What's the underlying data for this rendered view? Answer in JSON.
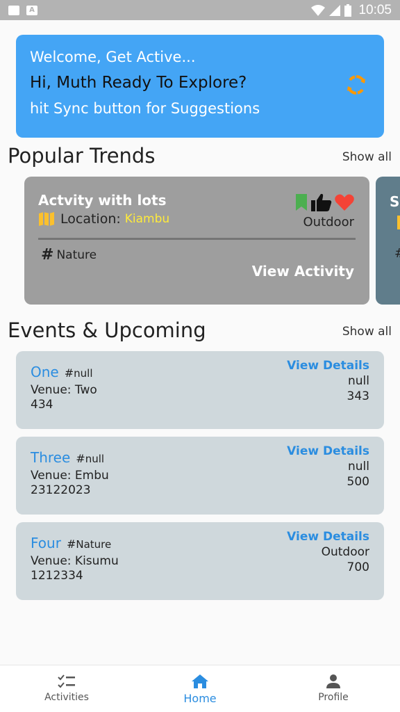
{
  "status_bar": {
    "time": "10:05"
  },
  "hero": {
    "greeting": "Welcome, Get Active...",
    "user_line": "Hi, Muth Ready To Explore?",
    "hint": "hit Sync button for Suggestions",
    "sync_icon": "sync-icon"
  },
  "popular": {
    "title": "Popular Trends",
    "show_all": "Show all",
    "cards": [
      {
        "title": "Actvity with lots",
        "location_label": "Location:",
        "location": "Kiambu",
        "category": "Outdoor",
        "tag": "Nature",
        "action": "View Activity",
        "next_card_letter": "S"
      }
    ]
  },
  "events": {
    "title": "Events & Upcoming",
    "show_all": "Show all",
    "items": [
      {
        "name": "One",
        "tag": "null",
        "venue_label": "Venue:",
        "venue": "Two",
        "code": "434",
        "action": "View Details",
        "category": "null",
        "number": "343"
      },
      {
        "name": "Three",
        "tag": "null",
        "venue_label": "Venue:",
        "venue": "Embu",
        "code": "23122023",
        "action": "View Details",
        "category": "null",
        "number": "500"
      },
      {
        "name": "Four",
        "tag": "Nature",
        "venue_label": "Venue:",
        "venue": "Kisumu",
        "code": "1212334",
        "action": "View Details",
        "category": "Outdoor",
        "number": "700"
      }
    ]
  },
  "nav": {
    "items": [
      {
        "label": "Activities"
      },
      {
        "label": "Home"
      },
      {
        "label": "Profile"
      }
    ],
    "active": "Home"
  },
  "colors": {
    "accent": "#44a5f5",
    "link": "#2b8de0",
    "sync": "#ff9800",
    "bookmark": "#4caf50",
    "heart": "#f44336"
  }
}
